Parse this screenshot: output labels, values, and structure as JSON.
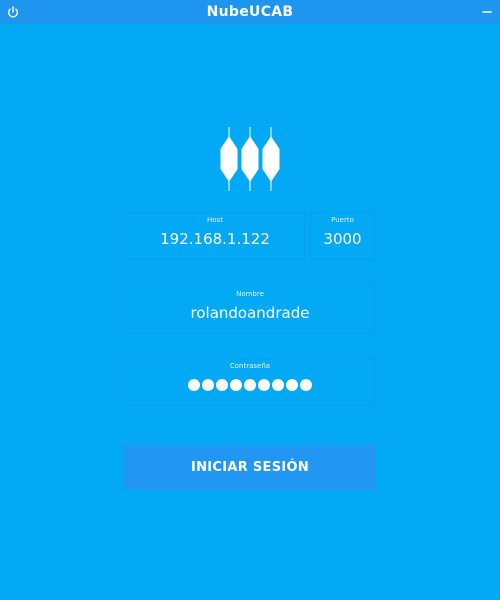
{
  "window": {
    "title": "NubeUCAB",
    "power_icon": "power-icon",
    "minimize_icon": "minimize-icon"
  },
  "logo": {
    "icon": "nube-logo-icon"
  },
  "form": {
    "host": {
      "label": "Host",
      "value": "192.168.1.122"
    },
    "port": {
      "label": "Puerto",
      "value": "3000"
    },
    "username": {
      "label": "Nombre",
      "value": "rolandoandrade"
    },
    "password": {
      "label": "Contraseña",
      "masked_length": 9
    }
  },
  "login_button": {
    "label": "INICIAR SESIÓN"
  },
  "colors": {
    "background": "#03a9f4",
    "titlebar": "#1e96f0",
    "button": "#2196f3",
    "text": "#ffffff"
  }
}
